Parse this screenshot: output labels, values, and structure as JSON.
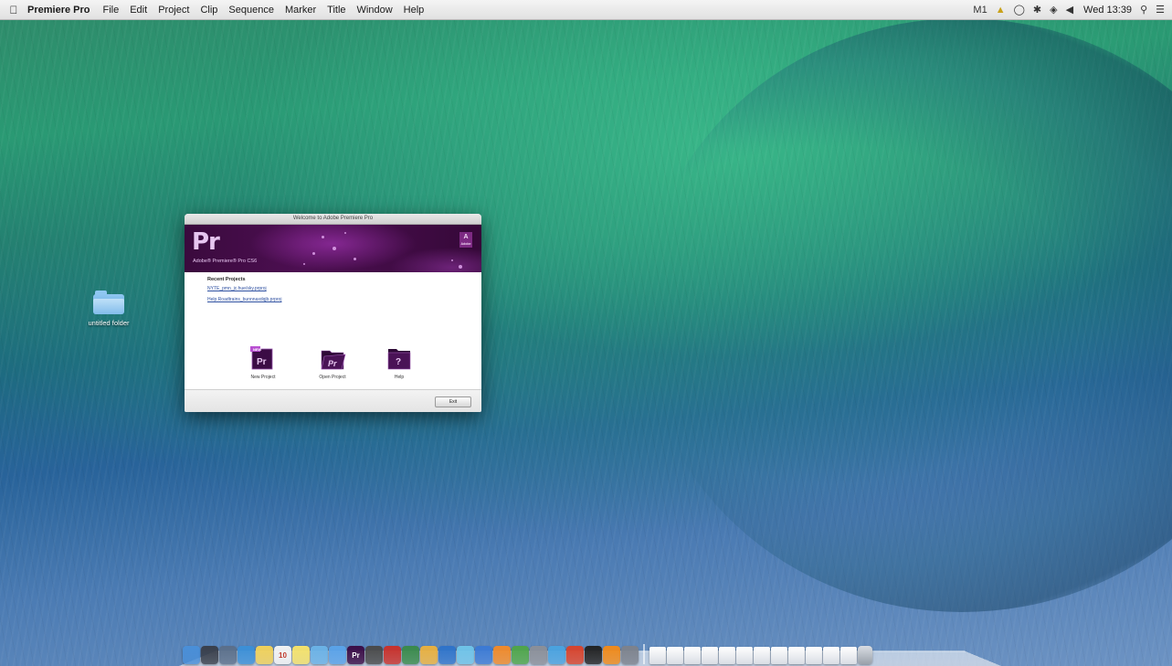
{
  "menubar": {
    "app_name": "Premiere Pro",
    "items": [
      "File",
      "Edit",
      "Project",
      "Clip",
      "Sequence",
      "Marker",
      "Title",
      "Window",
      "Help"
    ],
    "status_text": "M1",
    "clock": "Wed 13:39"
  },
  "desktop": {
    "folder_label": "untitled folder"
  },
  "welcome": {
    "window_title": "Welcome to Adobe Premiere Pro",
    "logo_text": "Pr",
    "product_name": "Adobe® Premiere® Pro CS6",
    "adobe_logo": "A",
    "adobe_sub": "Adobe",
    "recent_heading": "Recent Projects",
    "recent_projects": [
      "NYTE_pmn_jc.hue/sky.prproj",
      "Help Roadtrains_bunnnaxdqjb.prproj"
    ],
    "actions": [
      {
        "label": "New Project",
        "badge": "NEW",
        "glyph": "Pr"
      },
      {
        "label": "Open Project",
        "glyph": "Pr"
      },
      {
        "label": "Help",
        "glyph": "?"
      }
    ],
    "exit_label": "Exit"
  },
  "dock": {
    "apps": [
      {
        "name": "finder",
        "color": "#4a8fd8",
        "glyph": ""
      },
      {
        "name": "dashboard",
        "color": "#3a3f4a",
        "glyph": ""
      },
      {
        "name": "mission-control",
        "color": "#5b6f8a",
        "glyph": ""
      },
      {
        "name": "safari",
        "color": "#3c8fd6",
        "glyph": ""
      },
      {
        "name": "notes",
        "color": "#f1d15a",
        "glyph": ""
      },
      {
        "name": "calendar",
        "color": "#f3f3f3",
        "glyph": "10"
      },
      {
        "name": "stickies",
        "color": "#f5e26b",
        "glyph": ""
      },
      {
        "name": "preview",
        "color": "#6bb2e6",
        "glyph": ""
      },
      {
        "name": "finder-2",
        "color": "#5aa2e8",
        "glyph": ""
      },
      {
        "name": "premiere-pro",
        "color": "#3b0d46",
        "glyph": "Pr"
      },
      {
        "name": "camera",
        "color": "#4a4a4a",
        "glyph": ""
      },
      {
        "name": "app-red",
        "color": "#c8312b",
        "glyph": ""
      },
      {
        "name": "app-green",
        "color": "#3a8a4b",
        "glyph": ""
      },
      {
        "name": "app-pencil",
        "color": "#e8b040",
        "glyph": ""
      },
      {
        "name": "app-blue",
        "color": "#2f73c9",
        "glyph": ""
      },
      {
        "name": "app-cyan",
        "color": "#6fc3e8",
        "glyph": ""
      },
      {
        "name": "app-itunes",
        "color": "#3c7ad4",
        "glyph": ""
      },
      {
        "name": "app-orange",
        "color": "#f08a2a",
        "glyph": ""
      },
      {
        "name": "app-chrome",
        "color": "#4fa54a",
        "glyph": ""
      },
      {
        "name": "app-photo",
        "color": "#8b8f98",
        "glyph": ""
      },
      {
        "name": "app-sky",
        "color": "#4aa2df",
        "glyph": ""
      },
      {
        "name": "app-red2",
        "color": "#d8432c",
        "glyph": ""
      },
      {
        "name": "terminal",
        "color": "#222222",
        "glyph": ""
      },
      {
        "name": "vlc",
        "color": "#f08a1a",
        "glyph": ""
      },
      {
        "name": "app-gray",
        "color": "#7d828c",
        "glyph": ""
      }
    ],
    "docs_count_label": "",
    "docs": [
      "doc-1",
      "doc-2",
      "doc-3",
      "doc-4",
      "doc-5",
      "doc-6",
      "doc-7",
      "doc-8",
      "doc-9",
      "doc-10",
      "doc-11",
      "doc-12"
    ],
    "trash": "trash"
  }
}
